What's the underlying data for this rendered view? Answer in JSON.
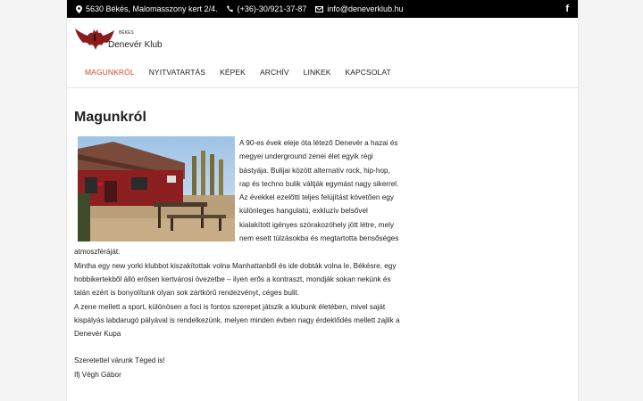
{
  "topbar": {
    "address": "5630 Békés, Malomasszony kert 2/4.",
    "phone": "(+36)-30/921-37-87",
    "email": "info@deneverklub.hu",
    "facebook_icon": "f"
  },
  "logo": {
    "small": "BÉKÉS",
    "main": "Denevér Klub"
  },
  "nav": {
    "items": [
      {
        "label": "MAGUNKRÓL",
        "active": true
      },
      {
        "label": "NYITVATARTÁS"
      },
      {
        "label": "KÉPEK"
      },
      {
        "label": "ARCHÍV"
      },
      {
        "label": "LINKEK"
      },
      {
        "label": "KAPCSOLAT"
      }
    ]
  },
  "page": {
    "title": "Magunkról",
    "p1": "A 90-es évek eleje óta létező Denevér a hazai és megyei underground zenei élet egyik régi bástyája. Bulijai között alternatív rock, hip-hop, rap és techno bulik váltják egymást nagy sikerrel.",
    "p2": "Az évekkel ezelőtti teljes felújítást követően egy különleges hangulatú, exkluzív belsővel kialakított igényes szórakozóhely jött létre, mely nem esett túlzásokba és megtartotta bensőséges atmoszféráját.",
    "p3": "Mintha egy new yorki klubbot kiszakítottak volna Manhattanből és ide dobták volna le, Békésre, egy hobbikertekből álló erősen kertvárosi övezetbe – ilyen erős a kontraszt, mondják sokan nekünk és talán ezért is bonyolítunk olyan sok zártkörű rendezvényt, céges bulit.",
    "p4": "A zene mellett a sport, különösen a foci is fontos szerepet játszik a klubunk életében, mivel saját kispályás labdarugó pályával is rendelkezünk, melyen minden évben nagy érdeklődés mellett zajlik a Denevér Kupa",
    "greeting": "Szeretettel várunk Téged is!",
    "signature": "Ifj Végh Gábor"
  }
}
